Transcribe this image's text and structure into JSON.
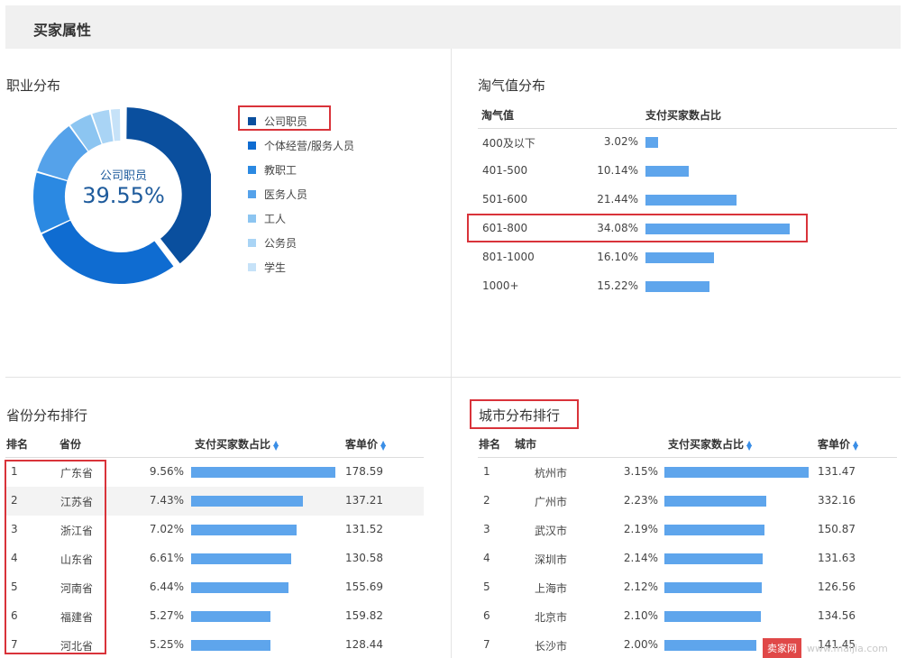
{
  "header": {
    "title": "买家属性"
  },
  "occupation": {
    "title": "职业分布",
    "center_label": "公司职员",
    "center_value": "39.55%",
    "legend": [
      {
        "label": "公司职员",
        "color": "#0a4f9e",
        "value": 39.55
      },
      {
        "label": "个体经营/服务人员",
        "color": "#0f6cd1",
        "value": 28.5
      },
      {
        "label": "教职工",
        "color": "#2b89e2",
        "value": 11.5
      },
      {
        "label": "医务人员",
        "color": "#55a2ea",
        "value": 10.5
      },
      {
        "label": "工人",
        "color": "#8cc5f1",
        "value": 4.5
      },
      {
        "label": "公务员",
        "color": "#a9d4f5",
        "value": 3.45
      },
      {
        "label": "学生",
        "color": "#c6e2f8",
        "value": 2.0
      }
    ]
  },
  "taoqi": {
    "title": "淘气值分布",
    "col_range": "淘气值",
    "col_share": "支付买家数占比",
    "rows": [
      {
        "range": "400及以下",
        "pct": "3.02%",
        "value": 3.02
      },
      {
        "range": "401-500",
        "pct": "10.14%",
        "value": 10.14
      },
      {
        "range": "501-600",
        "pct": "21.44%",
        "value": 21.44
      },
      {
        "range": "601-800",
        "pct": "34.08%",
        "value": 34.08
      },
      {
        "range": "801-1000",
        "pct": "16.10%",
        "value": 16.1
      },
      {
        "range": "1000+",
        "pct": "15.22%",
        "value": 15.22
      }
    ]
  },
  "province": {
    "title": "省份分布排行",
    "col_rank": "排名",
    "col_name": "省份",
    "col_share": "支付买家数占比",
    "col_price": "客单价",
    "rows": [
      {
        "rank": "1",
        "name": "广东省",
        "pct": "9.56%",
        "value": 9.56,
        "price": "178.59"
      },
      {
        "rank": "2",
        "name": "江苏省",
        "pct": "7.43%",
        "value": 7.43,
        "price": "137.21"
      },
      {
        "rank": "3",
        "name": "浙江省",
        "pct": "7.02%",
        "value": 7.02,
        "price": "131.52"
      },
      {
        "rank": "4",
        "name": "山东省",
        "pct": "6.61%",
        "value": 6.61,
        "price": "130.58"
      },
      {
        "rank": "5",
        "name": "河南省",
        "pct": "6.44%",
        "value": 6.44,
        "price": "155.69"
      },
      {
        "rank": "6",
        "name": "福建省",
        "pct": "5.27%",
        "value": 5.27,
        "price": "159.82"
      },
      {
        "rank": "7",
        "name": "河北省",
        "pct": "5.25%",
        "value": 5.25,
        "price": "128.44"
      }
    ]
  },
  "city": {
    "title": "城市分布排行",
    "col_rank": "排名",
    "col_name": "城市",
    "col_share": "支付买家数占比",
    "col_price": "客单价",
    "rows": [
      {
        "rank": "1",
        "name": "杭州市",
        "pct": "3.15%",
        "value": 3.15,
        "price": "131.47"
      },
      {
        "rank": "2",
        "name": "广州市",
        "pct": "2.23%",
        "value": 2.23,
        "price": "332.16"
      },
      {
        "rank": "3",
        "name": "武汉市",
        "pct": "2.19%",
        "value": 2.19,
        "price": "150.87"
      },
      {
        "rank": "4",
        "name": "深圳市",
        "pct": "2.14%",
        "value": 2.14,
        "price": "131.63"
      },
      {
        "rank": "5",
        "name": "上海市",
        "pct": "2.12%",
        "value": 2.12,
        "price": "126.56"
      },
      {
        "rank": "6",
        "name": "北京市",
        "pct": "2.10%",
        "value": 2.1,
        "price": "134.56"
      },
      {
        "rank": "7",
        "name": "长沙市",
        "pct": "2.00%",
        "value": 2.0,
        "price": "141.45"
      }
    ]
  },
  "watermark": {
    "badge": "卖家网",
    "url": "www.maijia.com"
  },
  "colors": {
    "bar": "#5ea5ec",
    "highlight": "#d9333a",
    "accent": "#1e5b9c"
  }
}
